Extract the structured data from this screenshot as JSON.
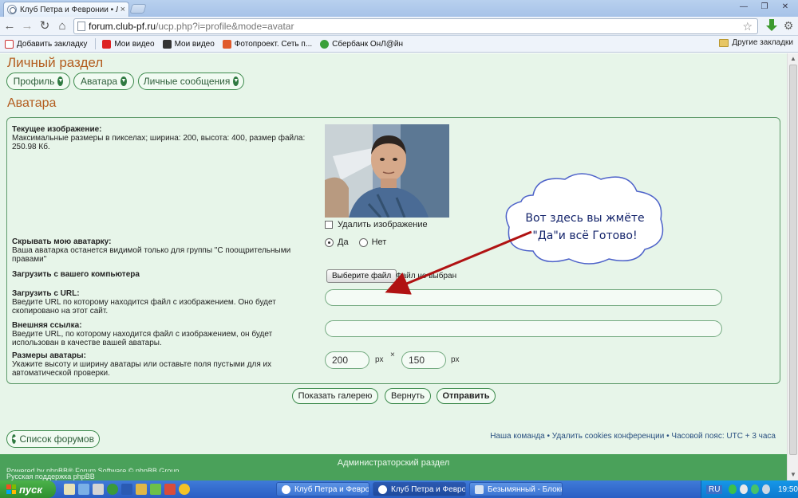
{
  "browser": {
    "tab_title": "Клуб Петра и Февронии • Ли",
    "tab_close": "×",
    "url_host": "forum.club-pf.ru",
    "url_path": "/ucp.php?i=profile&mode=avatar",
    "bookmarks": [
      {
        "label": "Добавить закладку",
        "color": "#e04848"
      },
      {
        "label": "Мои видео",
        "color": "#d22"
      },
      {
        "label": "Мои видео",
        "color": "#333"
      },
      {
        "label": "Фотопроект. Сеть п...",
        "color": "#e05a2b"
      },
      {
        "label": "Сбербанк ОнЛ@йн",
        "color": "#3ba03b"
      }
    ],
    "other_bookmarks": "Другие закладки"
  },
  "page": {
    "section_title": "Личный раздел",
    "nav_tabs": [
      "Профиль",
      "Аватара",
      "Личные сообщения"
    ],
    "avatar_heading": "Аватара",
    "current_image_label": "Текущее изображение:",
    "current_image_desc": "Максимальные размеры в пикселах; ширина: 200, высота: 400, размер файла: 250.98 Кб.",
    "delete_image": "Удалить изображение",
    "hide_label": "Скрывать мою аватарку:",
    "hide_desc": "Ваша аватарка останется видимой только для группы \"С поощрительными правами\"",
    "radio_yes": "Да",
    "radio_no": "Нет",
    "upload_pc_label": "Загрузить с вашего компьютера",
    "file_button": "Выберите файл",
    "file_status": "Файл не выбран",
    "upload_url_label": "Загрузить с URL:",
    "upload_url_desc": "Введите URL по которому находится файл с изображением. Оно будет скопировано на этот сайт.",
    "external_label": "Внешняя ссылка:",
    "external_desc": "Введите URL, по которому находится файл с изображением, он будет использован в качестве вашей аватары.",
    "size_label": "Размеры аватары:",
    "size_desc": "Укажите высоту и ширину аватары или оставьте поля пустыми для их автоматической проверки.",
    "width_value": "200",
    "height_value": "150",
    "unit": "px",
    "times": "×",
    "btn_gallery": "Показать галерею",
    "btn_reset": "Вернуть",
    "btn_submit": "Отправить",
    "forum_list": "Список форумов",
    "footer_links": "Наша команда • Удалить cookies конференции • Часовой пояс: UTC + 3 часа",
    "admin_bar": "Администраторский раздел",
    "powered": "Powered by phpBB® Forum Software © phpBB Group",
    "powered2": "Русская поддержка phpBB"
  },
  "callout": {
    "line1": "Вот здесь вы жмёте",
    "line2": "\"Да\"и всё Готово!"
  },
  "taskbar": {
    "start": "пуск",
    "tasks": [
      "Клуб Петра и Февро...",
      "Клуб Петра и Февро...",
      "Безымянный - Блокнот"
    ],
    "lang": "RU",
    "clock": "19:50"
  },
  "colors": {
    "accent_orange": "#b35c1e",
    "forum_green": "#4aa15a",
    "page_bg": "#e7f5e9",
    "callout_text": "#14246b",
    "arrow_red": "#b01212"
  }
}
